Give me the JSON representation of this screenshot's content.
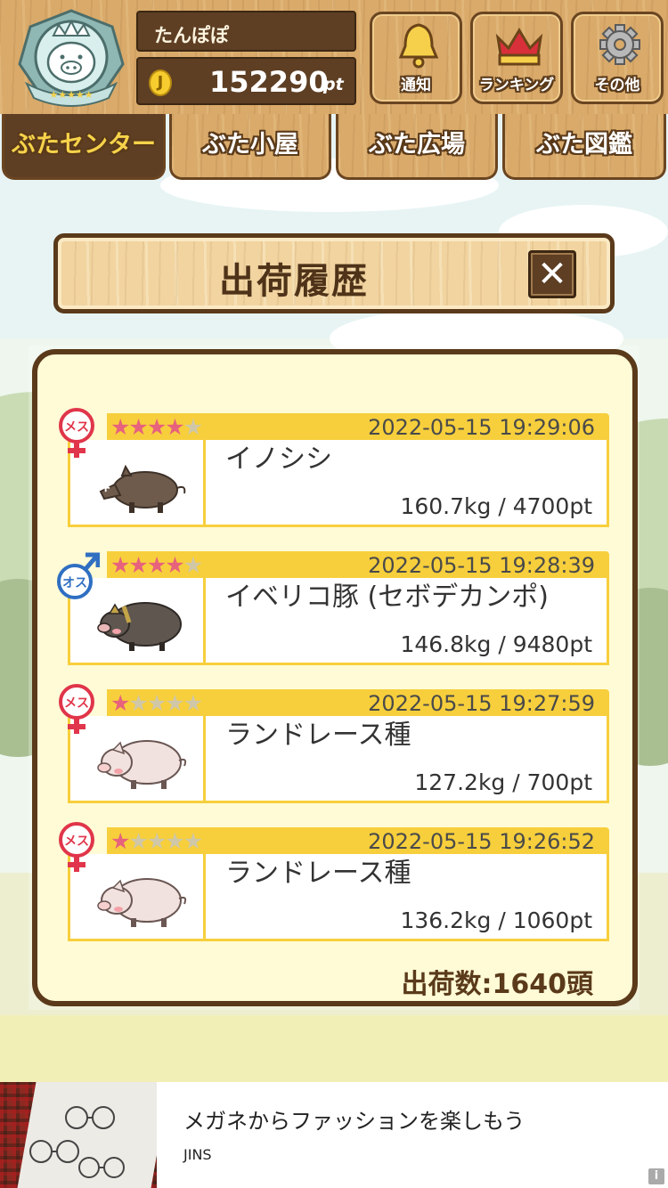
{
  "header": {
    "username": "たんぽぽ",
    "points_value": "152290",
    "points_unit": "pt",
    "coin_symbol": "J",
    "buttons": [
      {
        "label": "通知",
        "icon": "bell-icon"
      },
      {
        "label": "ランキング",
        "icon": "crown-icon"
      },
      {
        "label": "その他",
        "icon": "gear-icon"
      }
    ]
  },
  "tabs": [
    {
      "label": "ぶたセンター",
      "active": true
    },
    {
      "label": "ぶた小屋",
      "active": false
    },
    {
      "label": "ぶた広場",
      "active": false
    },
    {
      "label": "ぶた図鑑",
      "active": false
    }
  ],
  "dialog": {
    "title": "出荷履歴",
    "close_symbol": "✕",
    "entries": [
      {
        "gender_label": "メス",
        "gender": "female",
        "stars": 4,
        "max_stars": 5,
        "datetime": "2022-05-15 19:29:06",
        "name": "イノシシ",
        "weight_points": "160.7kg / 4700pt",
        "animal": "boar"
      },
      {
        "gender_label": "オス",
        "gender": "male",
        "stars": 4,
        "max_stars": 5,
        "datetime": "2022-05-15 19:28:39",
        "name": "イベリコ豚 (セボデカンポ)",
        "weight_points": "146.8kg / 9480pt",
        "animal": "iberico-pig"
      },
      {
        "gender_label": "メス",
        "gender": "female",
        "stars": 1,
        "max_stars": 5,
        "datetime": "2022-05-15 19:27:59",
        "name": "ランドレース種",
        "weight_points": "127.2kg / 700pt",
        "animal": "landrace-pig"
      },
      {
        "gender_label": "メス",
        "gender": "female",
        "stars": 1,
        "max_stars": 5,
        "datetime": "2022-05-15 19:26:52",
        "name": "ランドレース種",
        "weight_points": "136.2kg / 1060pt",
        "animal": "landrace-pig"
      }
    ],
    "total": "出荷数:1640頭"
  },
  "ad": {
    "title": "メガネからファッションを楽しもう",
    "brand": "JINS",
    "info_symbol": "i"
  },
  "colors": {
    "wood": "#d9aa6a",
    "dark_brown": "#5e3f24",
    "accent_yellow": "#f7cf3c",
    "star_on": "#e7627c",
    "female_red": "#e0354a",
    "male_blue": "#2f6fc2"
  }
}
